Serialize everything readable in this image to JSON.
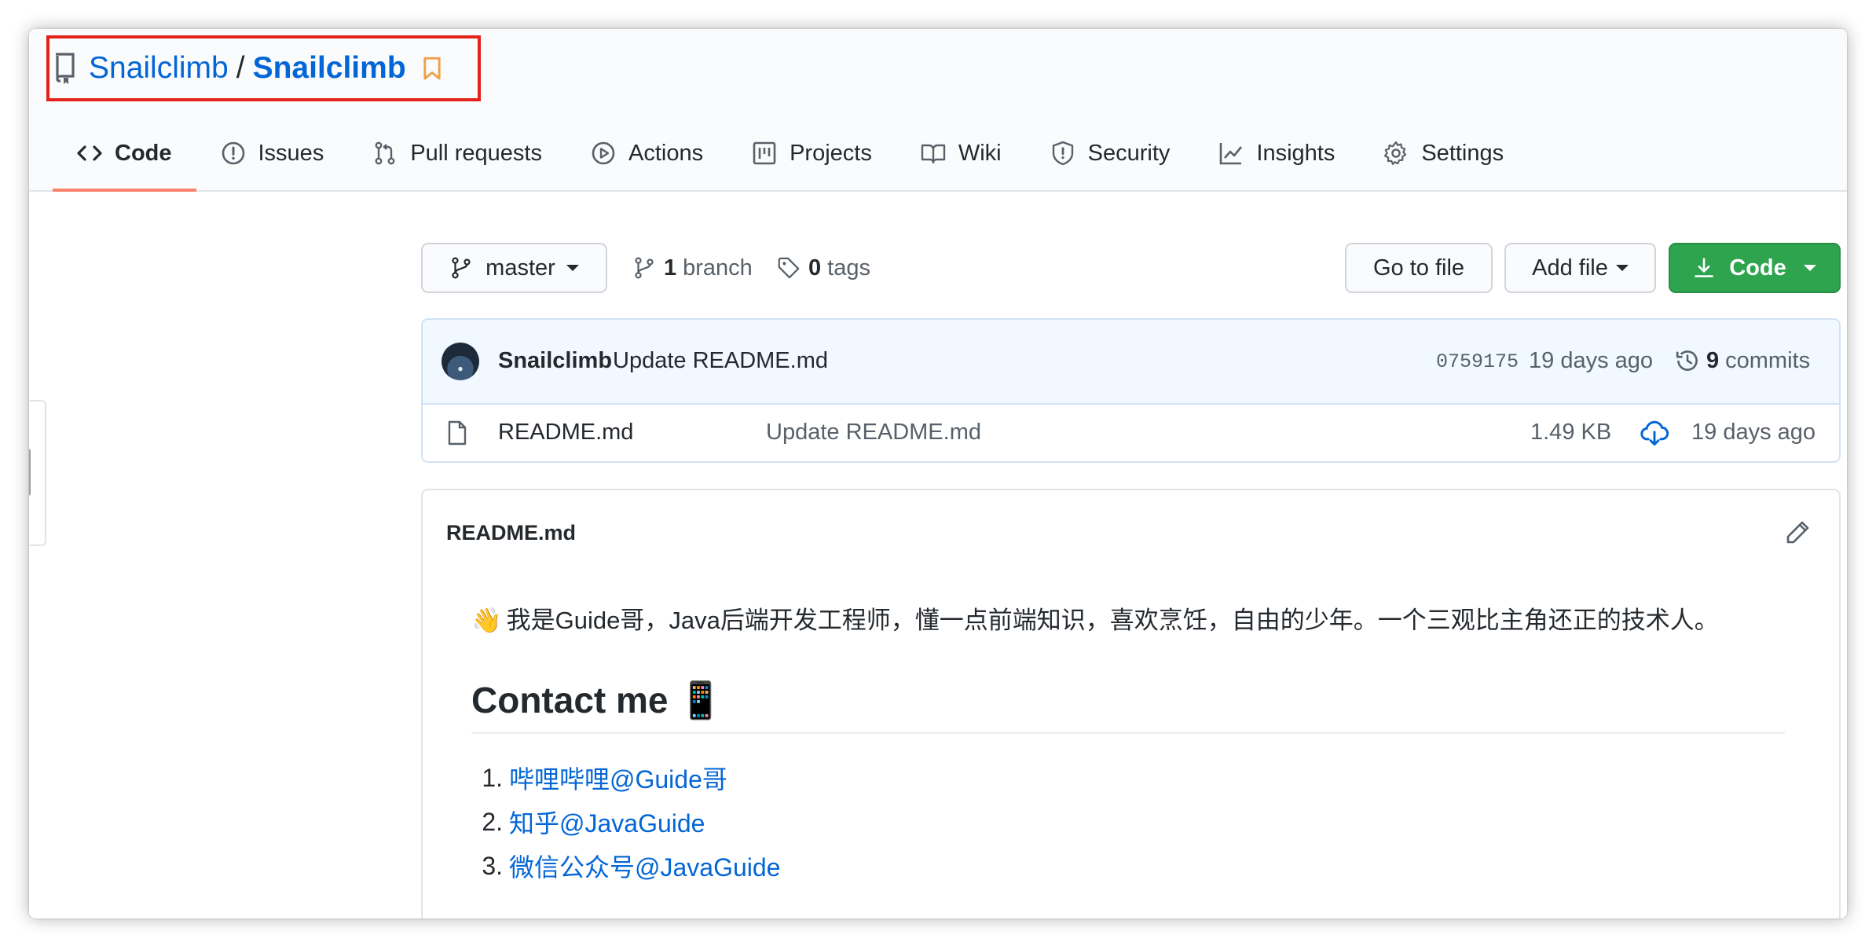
{
  "repo": {
    "owner": "Snailclimb",
    "separator": "/",
    "name": "Snailclimb"
  },
  "tabs": [
    {
      "label": "Code",
      "icon": "code-icon"
    },
    {
      "label": "Issues",
      "icon": "issue-icon"
    },
    {
      "label": "Pull requests",
      "icon": "pull-request-icon"
    },
    {
      "label": "Actions",
      "icon": "play-icon"
    },
    {
      "label": "Projects",
      "icon": "project-icon"
    },
    {
      "label": "Wiki",
      "icon": "book-icon"
    },
    {
      "label": "Security",
      "icon": "shield-icon"
    },
    {
      "label": "Insights",
      "icon": "graph-icon"
    },
    {
      "label": "Settings",
      "icon": "gear-icon"
    }
  ],
  "toolbar": {
    "branch": "master",
    "branch_count": "1",
    "branch_label": "branch",
    "tag_count": "0",
    "tag_label": "tags",
    "go_to_file": "Go to file",
    "add_file": "Add file",
    "code": "Code"
  },
  "commit": {
    "author": "Snailclimb",
    "message": "Update README.md",
    "sha": "0759175",
    "time": "19 days ago",
    "count": "9",
    "count_label": "commits"
  },
  "files": [
    {
      "name": "README.md",
      "message": "Update README.md",
      "size": "1.49 KB",
      "time": "19 days ago"
    }
  ],
  "readme": {
    "filename": "README.md",
    "intro_emoji": "👋",
    "intro": "我是Guide哥，Java后端开发工程师，懂一点前端知识，喜欢烹饪，自由的少年。一个三观比主角还正的技术人。",
    "heading": "Contact me",
    "heading_emoji": "📱",
    "contacts": [
      {
        "num": "1.",
        "label": "哔哩哔哩@Guide哥"
      },
      {
        "num": "2.",
        "label": "知乎@JavaGuide"
      },
      {
        "num": "3.",
        "label": "微信公众号@JavaGuide"
      }
    ]
  },
  "colors": {
    "link": "#0366d6",
    "selected_tab_underline": "#f9826c",
    "primary_button": "#2ea44f",
    "highlight_box": "#e2231a"
  }
}
